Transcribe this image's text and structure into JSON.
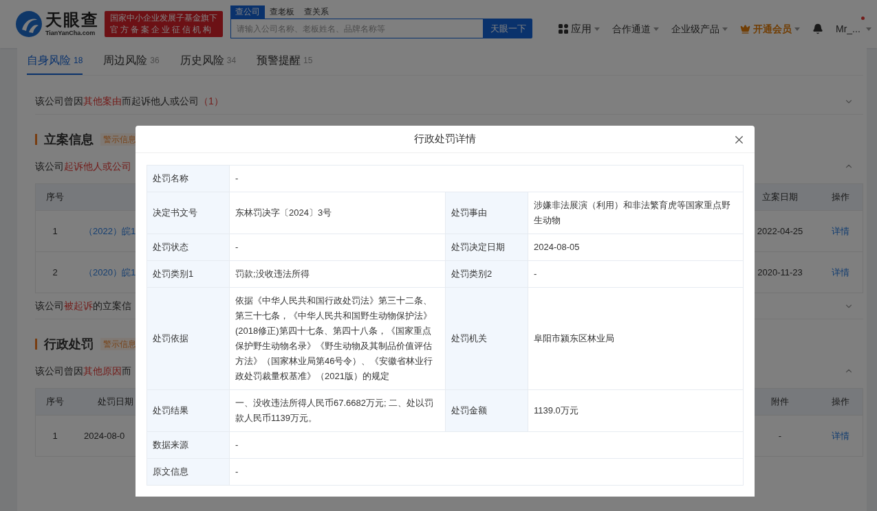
{
  "header": {
    "logo": {
      "name": "天眼查",
      "domain": "TianYanCha.com"
    },
    "badge_lines": [
      "国家中小企业发展子基金旗下",
      "官方备案企业征信机构"
    ],
    "search_tabs": [
      {
        "label": "查公司",
        "selected": true
      },
      {
        "label": "查老板",
        "selected": false
      },
      {
        "label": "查关系",
        "selected": false
      }
    ],
    "search": {
      "placeholder": "请输入公司名称、老板姓名、品牌名称等"
    },
    "search_button": "天眼一下",
    "nav": [
      {
        "kind": "apps",
        "label": "应用"
      },
      {
        "kind": "menu",
        "label": "合作通道"
      },
      {
        "kind": "menu",
        "label": "企业级产品"
      },
      {
        "kind": "vip",
        "label": "开通会员"
      },
      {
        "kind": "bell"
      },
      {
        "kind": "user",
        "label": "Mr_...",
        "unread": true
      }
    ]
  },
  "tabs": [
    {
      "label": "自身风险",
      "count": "18",
      "selected": true
    },
    {
      "label": "周边风险",
      "count": "36",
      "selected": false
    },
    {
      "label": "历史风险",
      "count": "34",
      "selected": false
    },
    {
      "label": "预警提醒",
      "count": "15",
      "selected": false
    }
  ],
  "blocks": [
    {
      "kind": "summary",
      "expanded": false,
      "segments": [
        {
          "text": "该公司曾因"
        },
        {
          "text": "其他案由",
          "highlight": true
        },
        {
          "text": "而起诉他人或公司"
        },
        {
          "text": "（1）",
          "highlight": true
        }
      ]
    },
    {
      "kind": "heading",
      "title": "立案信息",
      "tag": "警示信息"
    },
    {
      "kind": "summary",
      "expanded": true,
      "segments": [
        {
          "text": "该公司"
        },
        {
          "text": "起诉他人或公司",
          "highlight": true
        }
      ]
    },
    {
      "kind": "table",
      "columns": {
        "leading": [
          "序号"
        ],
        "trailing": [
          "立案日期",
          "操作"
        ]
      },
      "rows": [
        {
          "leading": [
            {
              "kind": "text",
              "text": "1"
            },
            {
              "kind": "link",
              "text": "（2022）皖1"
            }
          ],
          "trailing": [
            {
              "kind": "text",
              "text": "2022-04-25"
            },
            {
              "kind": "link",
              "text": "详情"
            }
          ]
        },
        {
          "leading": [
            {
              "kind": "text",
              "text": "2"
            },
            {
              "kind": "link",
              "text": "（2020）皖1"
            }
          ],
          "trailing": [
            {
              "kind": "text",
              "text": "2020-11-23"
            },
            {
              "kind": "link",
              "text": "详情"
            }
          ]
        }
      ]
    },
    {
      "kind": "summary",
      "expanded": false,
      "segments": [
        {
          "text": "该公司"
        },
        {
          "text": "被起诉",
          "highlight": true
        },
        {
          "text": "的立案信"
        }
      ]
    },
    {
      "kind": "heading",
      "title": "行政处罚",
      "tag": "警示信息"
    },
    {
      "kind": "summary",
      "expanded": true,
      "segments": [
        {
          "text": "该公司曾因"
        },
        {
          "text": "其他原因",
          "highlight": true
        },
        {
          "text": "而"
        }
      ]
    },
    {
      "kind": "table",
      "columns": {
        "leading": [
          "序号",
          "处罚日期"
        ],
        "trailing": [
          "附件",
          "操作"
        ]
      },
      "rows": [
        {
          "leading": [
            {
              "kind": "text",
              "text": "1"
            },
            {
              "kind": "text",
              "text": "2024-08-0"
            }
          ],
          "trailing": [
            {
              "kind": "text",
              "text": "-"
            },
            {
              "kind": "link",
              "text": "详情"
            }
          ]
        }
      ]
    }
  ],
  "dialog": {
    "title": "行政处罚详情",
    "rows": [
      {
        "fields": [
          {
            "label": "处罚名称",
            "value": "-"
          }
        ]
      },
      {
        "fields": [
          {
            "label": "决定书文号",
            "value": "东林罚决字〔2024〕3号"
          },
          {
            "label": "处罚事由",
            "value": "涉嫌非法展演（利用）和非法繁育虎等国家重点野生动物"
          }
        ]
      },
      {
        "fields": [
          {
            "label": "处罚状态",
            "value": "-"
          },
          {
            "label": "处罚决定日期",
            "value": "2024-08-05"
          }
        ]
      },
      {
        "fields": [
          {
            "label": "处罚类别1",
            "value": "罚款;没收违法所得"
          },
          {
            "label": "处罚类别2",
            "value": "-"
          }
        ]
      },
      {
        "fields": [
          {
            "label": "处罚依据",
            "value": "依据《中华人民共和国行政处罚法》第三十二条、第三十七条，《中华人民共和国野生动物保护法》(2018修正)第四十七条、第四十八条，《国家重点保护野生动物名录》《野生动物及其制品价值评估方法》（国家林业局第46号令）、《安徽省林业行政处罚裁量权基准》（2021版）的规定"
          },
          {
            "label": "处罚机关",
            "value": "阜阳市颍东区林业局"
          }
        ]
      },
      {
        "fields": [
          {
            "label": "处罚结果",
            "value": "一、没收违法所得人民币67.6682万元; 二、处以罚款人民币1139万元。"
          },
          {
            "label": "处罚金额",
            "value": "1139.0万元"
          }
        ]
      },
      {
        "fields": [
          {
            "label": "数据来源",
            "value": "-"
          }
        ]
      },
      {
        "fields": [
          {
            "label": "原文信息",
            "value": "-"
          }
        ]
      }
    ]
  }
}
